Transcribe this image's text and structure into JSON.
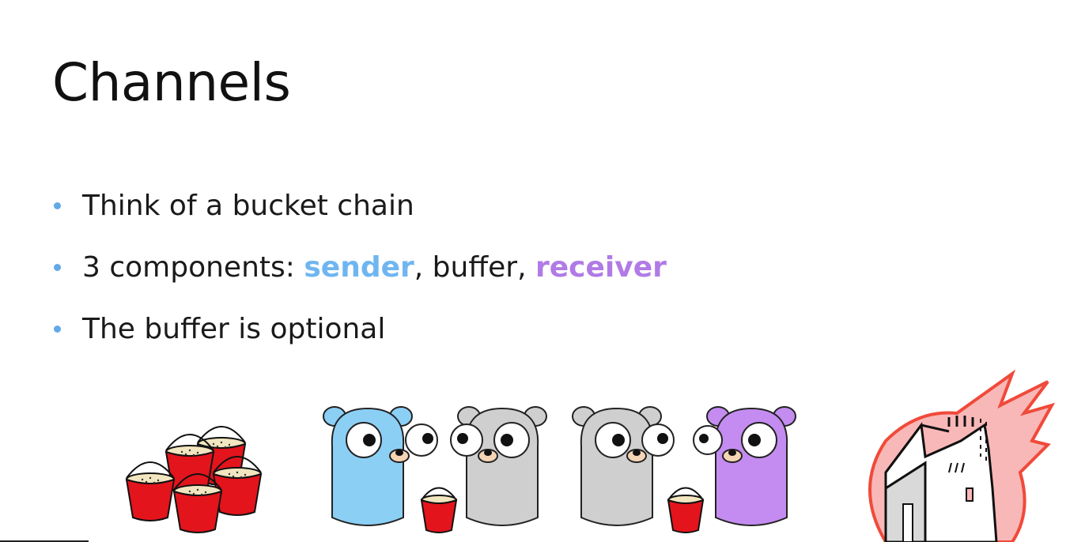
{
  "slide": {
    "title": "Channels",
    "bullets": [
      {
        "text": "Think of a bucket chain"
      },
      {
        "prefix": "3 components: ",
        "sender": "sender",
        "middle": ", buffer, ",
        "receiver": "receiver"
      },
      {
        "text": "The buffer is optional"
      }
    ]
  },
  "colors": {
    "bullet": "#63a9e8",
    "sender": "#6fb6f0",
    "receiver": "#b07be6",
    "gopher_blue": "#8ccff5",
    "gopher_gray": "#cfcfcf",
    "gopher_purple": "#c48cf0",
    "bucket_red": "#e3141c",
    "fire": "#f04a3a"
  },
  "illustrations": {
    "left": "bucket-pile",
    "middle": [
      "blue-gopher",
      "bucket",
      "gray-gopher",
      "gray-gopher",
      "bucket",
      "purple-gopher"
    ],
    "right": "burning-house"
  }
}
